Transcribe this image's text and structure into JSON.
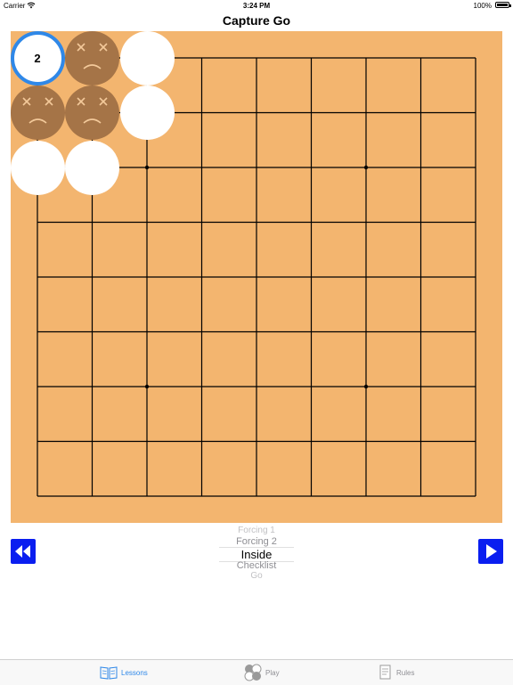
{
  "status_bar": {
    "carrier": "Carrier",
    "time": "3:24 PM",
    "battery": "100%"
  },
  "header": {
    "title": "Capture Go"
  },
  "board": {
    "size": 9,
    "stones": [
      {
        "col": 0,
        "row": 0,
        "color": "white",
        "state": "selected",
        "label": "2"
      },
      {
        "col": 1,
        "row": 0,
        "color": "black",
        "state": "captured"
      },
      {
        "col": 2,
        "row": 0,
        "color": "white",
        "state": "normal"
      },
      {
        "col": 0,
        "row": 1,
        "color": "black",
        "state": "captured"
      },
      {
        "col": 1,
        "row": 1,
        "color": "black",
        "state": "captured"
      },
      {
        "col": 2,
        "row": 1,
        "color": "white",
        "state": "normal"
      },
      {
        "col": 0,
        "row": 2,
        "color": "white",
        "state": "normal"
      },
      {
        "col": 1,
        "row": 2,
        "color": "white",
        "state": "normal"
      }
    ],
    "colors": {
      "wood": "#f3b56f",
      "captured_stone": "#a57447",
      "selected_ring": "#2f88e8"
    }
  },
  "controls": {
    "rewind_icon": "rewind-icon",
    "forward_icon": "play-icon",
    "button_color": "#0a1ef0"
  },
  "picker": {
    "items": [
      "Forcing 1",
      "Forcing 2",
      "Inside",
      "Checklist",
      "Go"
    ],
    "selected": "Inside"
  },
  "tabs": [
    {
      "label": "Lessons",
      "icon": "book-icon",
      "active": true
    },
    {
      "label": "Play",
      "icon": "stones-icon",
      "active": false
    },
    {
      "label": "Rules",
      "icon": "document-icon",
      "active": false
    }
  ]
}
